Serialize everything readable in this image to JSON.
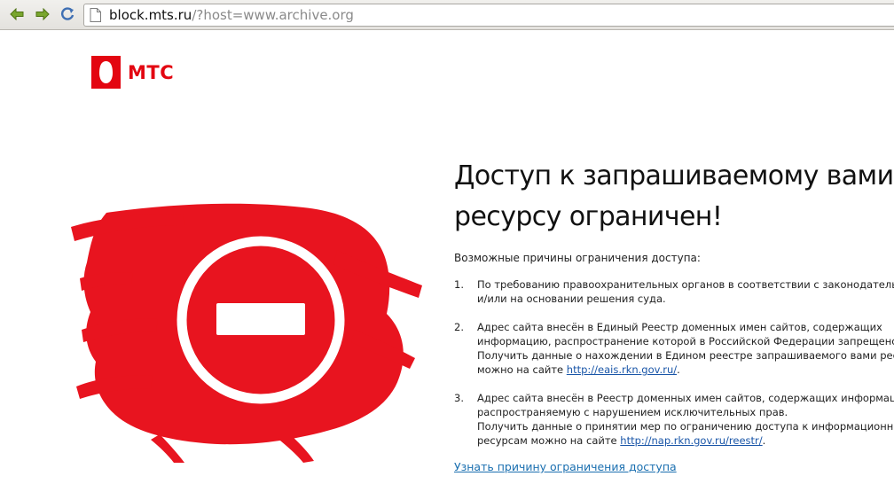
{
  "browser": {
    "back_icon": "back-arrow-icon",
    "forward_icon": "forward-arrow-icon",
    "reload_icon": "reload-icon",
    "url_host": "block.mts.ru",
    "url_query": "/?host=www.archive.org"
  },
  "logo": {
    "text": "МТС",
    "brand_color": "#e30611"
  },
  "main": {
    "headline_line1": "Доступ к запрашиваемому вами",
    "headline_line2": "ресурсу ограничен!",
    "reasons_intro": "Возможные причины ограничения доступа:",
    "reasons": [
      {
        "num": "1.",
        "line1": "По требованию правоохранительных органов в соответствии с законодательством",
        "line2": "и/или на основании решения суда."
      },
      {
        "num": "2.",
        "line1": "Адрес сайта внесён в Единый Реестр доменных имен сайтов, содержащих",
        "line2": "информацию, распространение которой в Российской Федерации запрещено.",
        "line3": "Получить данные о нахождении в Едином реестре запрашиваемого вами ресурса",
        "line4_prefix": "можно на сайте ",
        "link": "http://eais.rkn.gov.ru/",
        "line4_suffix": "."
      },
      {
        "num": "3.",
        "line1": "Адрес сайта внесён в Реестр доменных имен сайтов, содержащих информацию,",
        "line2": "распространяемую с нарушением исключительных прав.",
        "line3": "Получить данные о принятии мер по ограничению доступа к информационным",
        "line4_prefix": "ресурсам можно на сайте ",
        "link": "http://nap.rkn.gov.ru/reestr/",
        "line4_suffix": "."
      }
    ],
    "learn_more": "Узнать причину ограничения доступа"
  },
  "graphic": {
    "name": "stop-sign-icon",
    "accent": "#e8141f"
  }
}
